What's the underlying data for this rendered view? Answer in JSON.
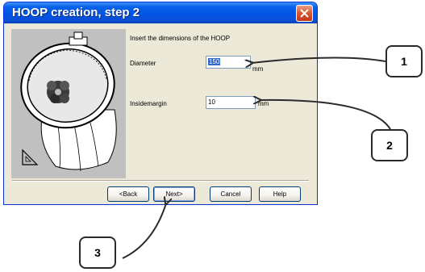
{
  "dialog": {
    "title": "HOOP creation, step 2",
    "instruction": "Insert the dimensions of the HOOP",
    "fields": [
      {
        "label": "Diameter",
        "value": "150",
        "unit": "mm"
      },
      {
        "label": "Insidemargin",
        "value": "10",
        "unit": "mm"
      }
    ],
    "buttons": {
      "back": "<Back",
      "next": "Next>",
      "cancel": "Cancel",
      "help": "Help"
    }
  },
  "callouts": [
    "1",
    "2",
    "3"
  ],
  "colors": {
    "titlebar": "#0054e3",
    "dialog_bg": "#ece9d8",
    "image_panel": "#c0c0c0",
    "close_button": "#d8572d"
  }
}
